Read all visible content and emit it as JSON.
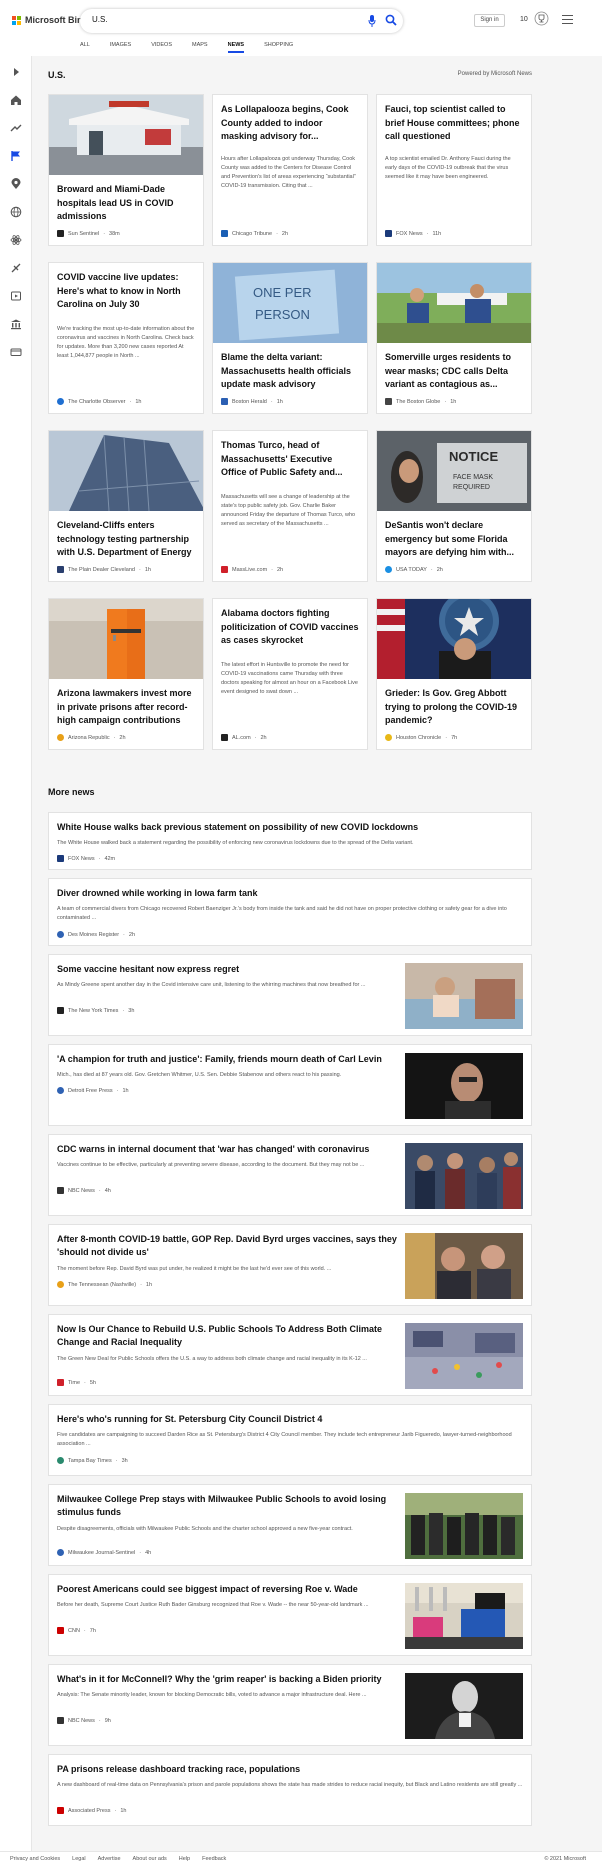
{
  "header": {
    "logo_text": "Microsoft Bing",
    "search_value": "U.S.",
    "signin_label": "Sign in",
    "rewards_count": "10",
    "brand_colors": [
      "#f25022",
      "#7fba00",
      "#00a4ef",
      "#ffb900"
    ],
    "accent_color": "#174ae4"
  },
  "tabs": [
    "ALL",
    "IMAGES",
    "VIDEOS",
    "MAPS",
    "NEWS",
    "SHOPPING"
  ],
  "active_tab": "NEWS",
  "rail_icons": [
    "expand-icon",
    "home-icon",
    "trending-icon",
    "flag-icon",
    "location-icon",
    "globe-icon",
    "science-icon",
    "sports-icon",
    "entertainment-icon",
    "business-icon",
    "money-icon"
  ],
  "section": {
    "title": "U.S.",
    "powered_by": "Powered by Microsoft News"
  },
  "cards": [
    {
      "title": "Broward and Miami-Dade hospitals lead US in COVID admissions",
      "snippet": "",
      "source": "Sun Sentinel",
      "time": "38m",
      "has_image": true,
      "logo_color": "#222222"
    },
    {
      "title": "As Lollapalooza begins, Cook County added to indoor masking advisory for...",
      "snippet": "Hours after Lollapalooza got underway Thursday, Cook County was added to the Centers for Disease Control and Prevention's list of areas experiencing “substantial” COVID-19 transmission. Citing that ...",
      "source": "Chicago Tribune",
      "time": "2h",
      "has_image": false,
      "logo_color": "#1a5fb4"
    },
    {
      "title": "Fauci, top scientist called to brief House committees; phone call questioned",
      "snippet": "A top scientist emailed Dr. Anthony Fauci during the early days of the COVID-19 outbreak that the virus seemed like it may have been engineered.",
      "source": "FOX News",
      "time": "11h",
      "has_image": false,
      "logo_color": "#1b3a7a"
    },
    {
      "title": "COVID vaccine live updates: Here's what to know in North Carolina on July 30",
      "snippet": "We're tracking the most up-to-date information about the coronavirus and vaccines in North Carolina. Check back for updates. More than 3,200 new cases reported At least 1,044,877 people in North ...",
      "source": "The Charlotte Observer",
      "time": "1h",
      "has_image": false,
      "logo_color": "#1f6fd1"
    },
    {
      "title": "Blame the delta variant: Massachusetts health officials update mask advisory",
      "snippet": "",
      "source": "Boston Herald",
      "time": "1h",
      "has_image": true,
      "logo_color": "#2b5fb3"
    },
    {
      "title": "Somerville urges residents to wear masks; CDC calls Delta variant as contagious as...",
      "snippet": "",
      "source": "The Boston Globe",
      "time": "1h",
      "has_image": true,
      "logo_color": "#444444"
    },
    {
      "title": "Cleveland-Cliffs enters technology testing partnership with U.S. Department of Energy",
      "snippet": "",
      "source": "The Plain Dealer Cleveland",
      "time": "1h",
      "has_image": true,
      "logo_color": "#2a3f6e"
    },
    {
      "title": "Thomas Turco, head of Massachusetts' Executive Office of Public Safety and...",
      "snippet": "Massachusetts will see a change of leadership at the state's top public safety job. Gov. Charlie Baker announced Friday the departure of Thomas Turco, who served as secretary of the Massachusetts ...",
      "source": "MassLive.com",
      "time": "2h",
      "has_image": false,
      "logo_color": "#d0202a"
    },
    {
      "title": "DeSantis won't declare emergency but some Florida mayors are defying him with...",
      "snippet": "",
      "source": "USA TODAY",
      "time": "2h",
      "has_image": true,
      "logo_color": "#1a8fe3"
    },
    {
      "title": "Arizona lawmakers invest more in private prisons after record-high campaign contributions",
      "snippet": "",
      "source": "Arizona Republic",
      "time": "2h",
      "has_image": true,
      "logo_color": "#e8a018"
    },
    {
      "title": "Alabama doctors fighting politicization of COVID vaccines as cases skyrocket",
      "snippet": "The latest effort in Huntsville to promote the need for COVID-19 vaccinations came Thursday with three doctors speaking for almost an hour on a Facebook Live event designed to swat down ...",
      "source": "AL.com",
      "time": "2h",
      "has_image": false,
      "logo_color": "#222222"
    },
    {
      "title": "Grieder: Is Gov. Greg Abbott trying to prolong the COVID-19 pandemic?",
      "snippet": "",
      "source": "Houston Chronicle",
      "time": "7h",
      "has_image": true,
      "logo_color": "#e8b818"
    }
  ],
  "more_news": {
    "title": "More news",
    "items": [
      {
        "title": "White House walks back previous statement on possibility of new COVID lockdowns",
        "snippet": "The White House walked back a statement regarding the possibility of enforcing new coronavirus lockdowns due to the spread of the Delta variant.",
        "source": "FOX News",
        "time": "42m",
        "has_image": false,
        "logo_color": "#1b3a7a"
      },
      {
        "title": "Diver drowned while working in Iowa farm tank",
        "snippet": "A team of commercial divers from Chicago recovered Robert Baenziger Jr.'s body from inside the tank and said he did not have on proper protective clothing or safety gear for a dive into contaminated ...",
        "source": "Des Moines Register",
        "time": "2h",
        "has_image": false,
        "logo_color": "#2f62b3"
      },
      {
        "title": "Some vaccine hesitant now express regret",
        "snippet": "As Mindy Greene spent another day in the Covid intensive care unit, listening to the whirring machines that now breathed for ...",
        "source": "The New York Times",
        "time": "3h",
        "has_image": true,
        "logo_color": "#222222"
      },
      {
        "title": "'A champion for truth and justice': Family, friends mourn death of Carl Levin",
        "snippet": "Mich., has died at 87 years old. Gov. Gretchen Whitmer, U.S. Sen. Debbie Stabenow and others react to his passing.",
        "source": "Detroit Free Press",
        "time": "1h",
        "has_image": true,
        "logo_color": "#2f62b3"
      },
      {
        "title": "CDC warns in internal document that 'war has changed' with coronavirus",
        "snippet": "Vaccines continue to be effective, particularly at preventing severe disease, according to the document. But they may not be ...",
        "source": "NBC News",
        "time": "4h",
        "has_image": true,
        "logo_color": "#333333"
      },
      {
        "title": "After 8-month COVID-19 battle, GOP Rep. David Byrd urges vaccines, says they 'should not divide us'",
        "snippet": "The moment before Rep. David Byrd was put under, he realized it might be the last he'd ever see of this world. ...",
        "source": "The Tennessean (Nashville)",
        "time": "1h",
        "has_image": true,
        "logo_color": "#e8a018"
      },
      {
        "title": "Now Is Our Chance to Rebuild U.S. Public Schools To Address Both Climate Change and Racial Inequality",
        "snippet": "The Green New Deal for Public Schools offers the U.S. a way to address both climate change and racial inequality in its K-12 ...",
        "source": "Time",
        "time": "5h",
        "has_image": true,
        "logo_color": "#d0202a"
      },
      {
        "title": "Here's who's running for St. Petersburg City Council District 4",
        "snippet": "Five candidates are campaigning to succeed Darden Rice as St. Petersburg's District 4 City Council member. They include tech entrepreneur Jarib Figueredo, lawyer-turned-neighborhood association ...",
        "source": "Tampa Bay Times",
        "time": "3h",
        "has_image": false,
        "logo_color": "#2a8a6e"
      },
      {
        "title": "Milwaukee College Prep stays with Milwaukee Public Schools to avoid losing stimulus funds",
        "snippet": "Despite disagreements, officials with Milwaukee Public Schools and the charter school approved a new five-year contract.",
        "source": "Milwaukee Journal-Sentinel",
        "time": "4h",
        "has_image": true,
        "logo_color": "#2f62b3"
      },
      {
        "title": "Poorest Americans could see biggest impact of reversing Roe v. Wade",
        "snippet": "Before her death, Supreme Court Justice Ruth Bader Ginsburg recognized that Roe v. Wade -- the near 50-year-old landmark ...",
        "source": "CNN",
        "time": "7h",
        "has_image": true,
        "logo_color": "#cc0000"
      },
      {
        "title": "What's in it for McConnell? Why the 'grim reaper' is backing a Biden priority",
        "snippet": "Analysis: The Senate minority leader, known for blocking Democratic bills, voted to advance a major infrastructure deal. Here ...",
        "source": "NBC News",
        "time": "9h",
        "has_image": true,
        "logo_color": "#333333"
      },
      {
        "title": "PA prisons release dashboard tracking race, populations",
        "snippet": "A new dashboard of real-time data on Pennsylvania's prison and parole populations shows the state has made strides to reduce racial inequity, but Black and Latino residents are still greatly ...",
        "source": "Associated Press",
        "time": "1h",
        "has_image": false,
        "logo_color": "#cc0000"
      }
    ]
  },
  "footer": {
    "links": [
      "Privacy and Cookies",
      "Legal",
      "Advertise",
      "About our ads",
      "Help",
      "Feedback"
    ],
    "copyright": "© 2021 Microsoft"
  }
}
